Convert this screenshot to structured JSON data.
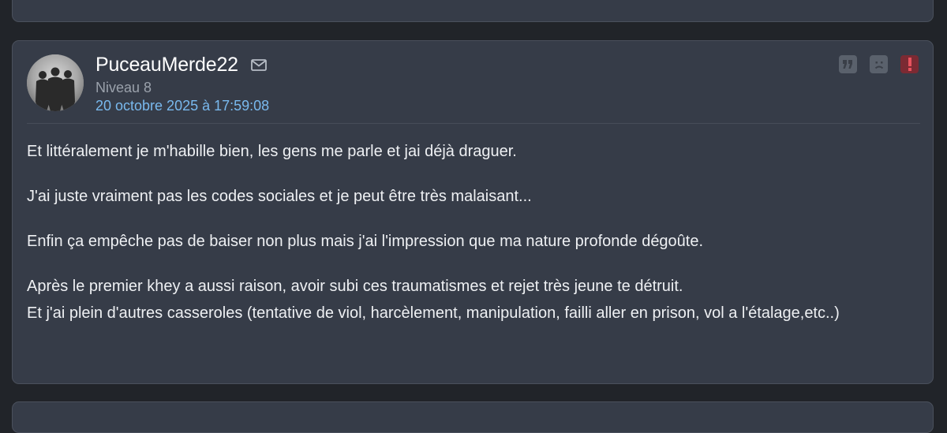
{
  "post": {
    "author": {
      "pseudo": "PuceauMerde22",
      "level": "Niveau 8",
      "avatar": "avatar-silhouettes-photo"
    },
    "date": "20 octobre 2025 à 17:59:08",
    "icons": {
      "message": "envelope-icon",
      "quote": "quote-icon",
      "blacklist": "sad-face-icon",
      "report": "exclamation-icon"
    },
    "colors": {
      "card_bg": "#363c48",
      "page_bg": "#212429",
      "date_link": "#79b9ee",
      "report_button": "#7b2a33"
    },
    "paragraphs": [
      {
        "text": "Et littéralement je m'habille bien, les gens me parle et jai déjà draguer."
      },
      {
        "text": "J'ai juste vraiment pas les codes sociales et je peut être très malaisant..."
      },
      {
        "text": "Enfin ça empêche pas de baiser non plus mais j'ai l'impression que ma nature profonde dégoûte."
      },
      {
        "lines": [
          "Après le premier khey a aussi raison, avoir subi ces traumatismes et rejet très jeune te détruit.",
          "Et j'ai plein d'autres casseroles (tentative de viol, harcèlement, manipulation, failli aller en prison, vol a l'étalage,etc..)"
        ]
      }
    ]
  }
}
